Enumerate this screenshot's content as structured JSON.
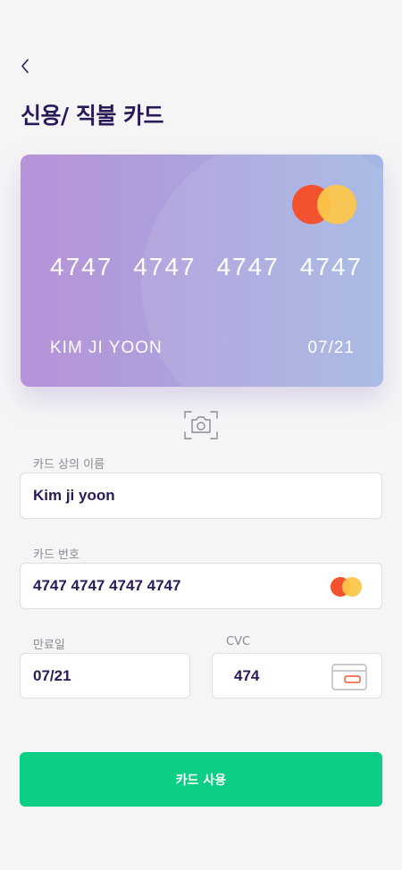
{
  "header": {
    "title": "신용/ 직불 카드",
    "back_icon": "chevron-left-icon"
  },
  "card": {
    "number_groups": [
      "4747",
      "4747",
      "4747",
      "4747"
    ],
    "holder": "KIM JI YOON",
    "expiry": "07/21",
    "brand_icon": "mastercard-logo-icon"
  },
  "scan": {
    "icon": "camera-scan-icon"
  },
  "form": {
    "name": {
      "label": "카드 상의 이름",
      "value": "Kim ji yoon"
    },
    "number": {
      "label": "카드 번호",
      "value": "4747 4747 4747 4747",
      "icon": "mastercard-icon"
    },
    "expiry": {
      "label": "만료일",
      "value": "07/21"
    },
    "cvc": {
      "label": "CVC",
      "value": "474",
      "icon": "card-back-icon"
    }
  },
  "submit": {
    "label": "카드 사용"
  },
  "colors": {
    "background": "#f5f5f6",
    "title": "#2a1a57",
    "accent": "#0ccf85",
    "card_gradient_start": "#b792d8",
    "card_gradient_end": "#a2b6e3",
    "mastercard_red": "#f2522e",
    "mastercard_yellow": "#fcc64a"
  }
}
